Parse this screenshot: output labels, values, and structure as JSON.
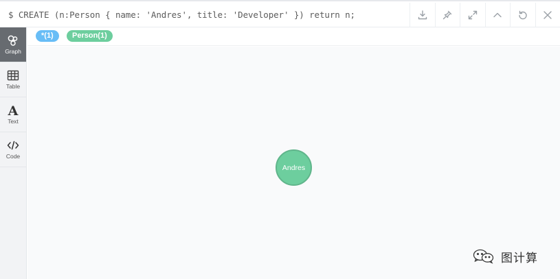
{
  "query": {
    "text": "$ CREATE (n:Person { name: 'Andres', title: 'Developer' }) return n;"
  },
  "actions": [
    {
      "icon": "download-icon"
    },
    {
      "icon": "pin-icon"
    },
    {
      "icon": "expand-icon"
    },
    {
      "icon": "collapse-up-icon"
    },
    {
      "icon": "rerun-icon"
    },
    {
      "icon": "close-icon"
    }
  ],
  "sidebar": {
    "items": [
      {
        "label": "Graph",
        "icon": "graph-icon",
        "active": true
      },
      {
        "label": "Table",
        "icon": "table-icon",
        "active": false
      },
      {
        "label": "Text",
        "icon": "text-icon",
        "active": false
      },
      {
        "label": "Code",
        "icon": "code-icon",
        "active": false
      }
    ]
  },
  "legend": {
    "all_label": "*(1)",
    "person_label": "Person(1)",
    "all_color": "#68bdf6",
    "person_color": "#6dce9e"
  },
  "graph": {
    "nodes": [
      {
        "label": "Andres",
        "color": "#6dce9e"
      }
    ]
  },
  "watermark": {
    "text": "图计算",
    "icon": "wechat-logo-icon"
  }
}
